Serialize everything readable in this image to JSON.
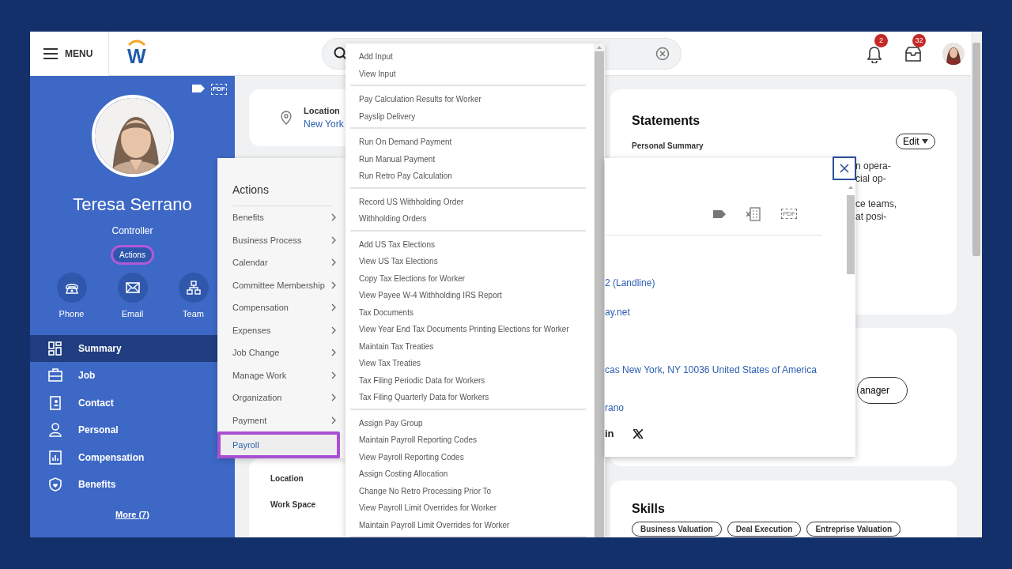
{
  "topbar": {
    "menu_label": "MENU",
    "logo": "W",
    "notifications": "2",
    "inbox": "32"
  },
  "profile": {
    "name": "Teresa Serrano",
    "title": "Controller",
    "actions_button": "Actions",
    "pdf_label": "PDF"
  },
  "quick_actions": [
    {
      "label": "Phone",
      "kind": "phone"
    },
    {
      "label": "Email",
      "kind": "email"
    },
    {
      "label": "Team",
      "kind": "team"
    }
  ],
  "nav": [
    {
      "label": "Summary",
      "kind": "summary",
      "selected": true
    },
    {
      "label": "Job",
      "kind": "job",
      "selected": false
    },
    {
      "label": "Contact",
      "kind": "contact",
      "selected": false
    },
    {
      "label": "Personal",
      "kind": "personal",
      "selected": false
    },
    {
      "label": "Compensation",
      "kind": "compensation",
      "selected": false
    },
    {
      "label": "Benefits",
      "kind": "benefits",
      "selected": false
    }
  ],
  "more": "More (7)",
  "location_card": {
    "label": "Location",
    "value": "New York"
  },
  "details": [
    "Location",
    "Work Space"
  ],
  "statements": {
    "title": "Statements",
    "subtitle": "Personal Summary",
    "edit": "Edit",
    "lines": [
      "n opera-",
      "cial op-",
      "ce teams,",
      "at posi-"
    ]
  },
  "manager_button": "anager",
  "skills": {
    "title": "Skills",
    "tags": [
      "Business Valuation",
      "Deal Execution",
      "Entreprise Valuation"
    ]
  },
  "actions_menu": {
    "title": "Actions",
    "items": [
      {
        "label": "Benefits",
        "submenu": true,
        "selected": false
      },
      {
        "label": "Business Process",
        "submenu": true,
        "selected": false
      },
      {
        "label": "Calendar",
        "submenu": true,
        "selected": false
      },
      {
        "label": "Committee Membership",
        "submenu": true,
        "selected": false
      },
      {
        "label": "Compensation",
        "submenu": true,
        "selected": false
      },
      {
        "label": "Expenses",
        "submenu": true,
        "selected": false
      },
      {
        "label": "Job Change",
        "submenu": true,
        "selected": false
      },
      {
        "label": "Manage Work",
        "submenu": true,
        "selected": false
      },
      {
        "label": "Organization",
        "submenu": true,
        "selected": false
      },
      {
        "label": "Payment",
        "submenu": true,
        "selected": false
      },
      {
        "label": "Payroll",
        "submenu": false,
        "selected": true
      }
    ]
  },
  "payroll_menu": [
    [
      "Add Input",
      "View Input"
    ],
    [
      "Pay Calculation Results for Worker",
      "Payslip Delivery"
    ],
    [
      "Run On Demand Payment",
      "Run Manual Payment",
      "Run Retro Pay Calculation"
    ],
    [
      "Record US Withholding Order",
      "Withholding Orders"
    ],
    [
      "Add US Tax Elections",
      "View US Tax Elections",
      "Copy Tax Elections for Worker",
      "View Payee W-4 Withholding IRS Report",
      "Tax Documents",
      "View Year End Tax Documents Printing Elections for Worker",
      "Maintain Tax Treaties",
      "View Tax Treaties",
      "Tax Filing Periodic Data for Workers",
      "Tax Filing Quarterly Data for Workers"
    ],
    [
      "Assign Pay Group",
      "Maintain Payroll Reporting Codes",
      "View Payroll Reporting Codes",
      "Assign Costing Allocation",
      "Change No Retro Processing Prior To",
      "View Payroll Limit Overrides for Worker",
      "Maintain Payroll Limit Overrides for Worker"
    ]
  ],
  "popup": {
    "pdf_label": "PDF",
    "phone": "2 (Landline)",
    "email": "ay.net",
    "address": "cas New York, NY 10036 United States of America",
    "manager": "rano",
    "linkedin": "in"
  }
}
